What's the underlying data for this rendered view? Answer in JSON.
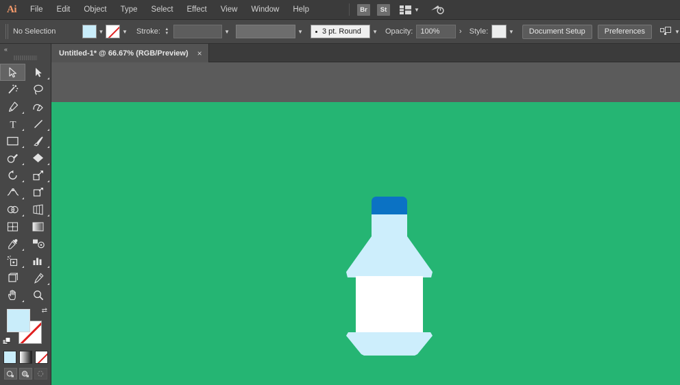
{
  "app": {
    "name": "Adobe Illustrator",
    "logo_text": "Ai",
    "logo_color": "#f59b6b"
  },
  "menubar": {
    "items": [
      {
        "label": "File"
      },
      {
        "label": "Edit"
      },
      {
        "label": "Object"
      },
      {
        "label": "Type"
      },
      {
        "label": "Select"
      },
      {
        "label": "Effect"
      },
      {
        "label": "View"
      },
      {
        "label": "Window"
      },
      {
        "label": "Help"
      }
    ],
    "bridge_badge": "Br",
    "stock_badge": "St",
    "workspace_icon": "workspace-switcher-icon",
    "workspace_chevron": "▼",
    "discover_icon": "discover-search-icon"
  },
  "controlbar": {
    "selection_status": "No Selection",
    "fill_label": "fill-swatch",
    "fill_color": "#c9edfa",
    "stroke_swatch_label": "stroke-swatch",
    "stroke_label": "Stroke:",
    "stroke_weight_value": "",
    "stroke_profile_value": "",
    "brush_value": "3 pt. Round",
    "opacity_label": "Opacity:",
    "opacity_value": "100%",
    "opacity_expand": "›",
    "style_label": "Style:",
    "style_swatch_color": "#eceded",
    "document_setup": "Document Setup",
    "preferences": "Preferences",
    "align_icon": "align-arrange-icon",
    "align_chevron": "▼",
    "chevron": "▼"
  },
  "tabbar": {
    "tab_title": "Untitled-1* @ 66.67% (RGB/Preview)",
    "close_glyph": "×"
  },
  "toolpanel": {
    "collapse_glyph": "«",
    "tools": [
      {
        "name": "selection-tool",
        "active": true,
        "more": false
      },
      {
        "name": "direct-selection-tool",
        "active": false,
        "more": true
      },
      {
        "name": "magic-wand-tool",
        "active": false,
        "more": false
      },
      {
        "name": "lasso-tool",
        "active": false,
        "more": false
      },
      {
        "name": "pen-tool",
        "active": false,
        "more": true
      },
      {
        "name": "curvature-tool",
        "active": false,
        "more": false
      },
      {
        "name": "type-tool",
        "active": false,
        "more": true
      },
      {
        "name": "line-segment-tool",
        "active": false,
        "more": true
      },
      {
        "name": "rectangle-tool",
        "active": false,
        "more": true
      },
      {
        "name": "paintbrush-tool",
        "active": false,
        "more": true
      },
      {
        "name": "shaper-pencil-tool",
        "active": false,
        "more": true
      },
      {
        "name": "eraser-tool",
        "active": false,
        "more": true
      },
      {
        "name": "rotate-tool",
        "active": false,
        "more": true
      },
      {
        "name": "scale-tool",
        "active": false,
        "more": true
      },
      {
        "name": "width-tool",
        "active": false,
        "more": true
      },
      {
        "name": "free-transform-tool",
        "active": false,
        "more": false
      },
      {
        "name": "shape-builder-tool",
        "active": false,
        "more": true
      },
      {
        "name": "perspective-grid-tool",
        "active": false,
        "more": true
      },
      {
        "name": "mesh-tool",
        "active": false,
        "more": false
      },
      {
        "name": "gradient-tool",
        "active": false,
        "more": false
      },
      {
        "name": "eyedropper-tool",
        "active": false,
        "more": true
      },
      {
        "name": "blend-tool",
        "active": false,
        "more": false
      },
      {
        "name": "symbol-sprayer-tool",
        "active": false,
        "more": true
      },
      {
        "name": "column-graph-tool",
        "active": false,
        "more": true
      },
      {
        "name": "artboard-tool",
        "active": false,
        "more": false
      },
      {
        "name": "slice-tool",
        "active": false,
        "more": true
      },
      {
        "name": "hand-tool",
        "active": false,
        "more": true
      },
      {
        "name": "zoom-tool",
        "active": false,
        "more": false
      }
    ],
    "fill_color": "#c9edfa",
    "stroke_color": "none",
    "swap_glyph": "⇄",
    "mode_color_label": "color-fill-mode",
    "mode_gradient_label": "gradient-fill-mode",
    "mode_none_label": "none-fill-mode"
  },
  "canvas": {
    "background_color": "#25b573",
    "artwork": {
      "name": "milk-bottle-illustration",
      "cap_color": "#0b72c4",
      "body_color": "#cdeefc",
      "label_color": "#ffffff"
    }
  }
}
